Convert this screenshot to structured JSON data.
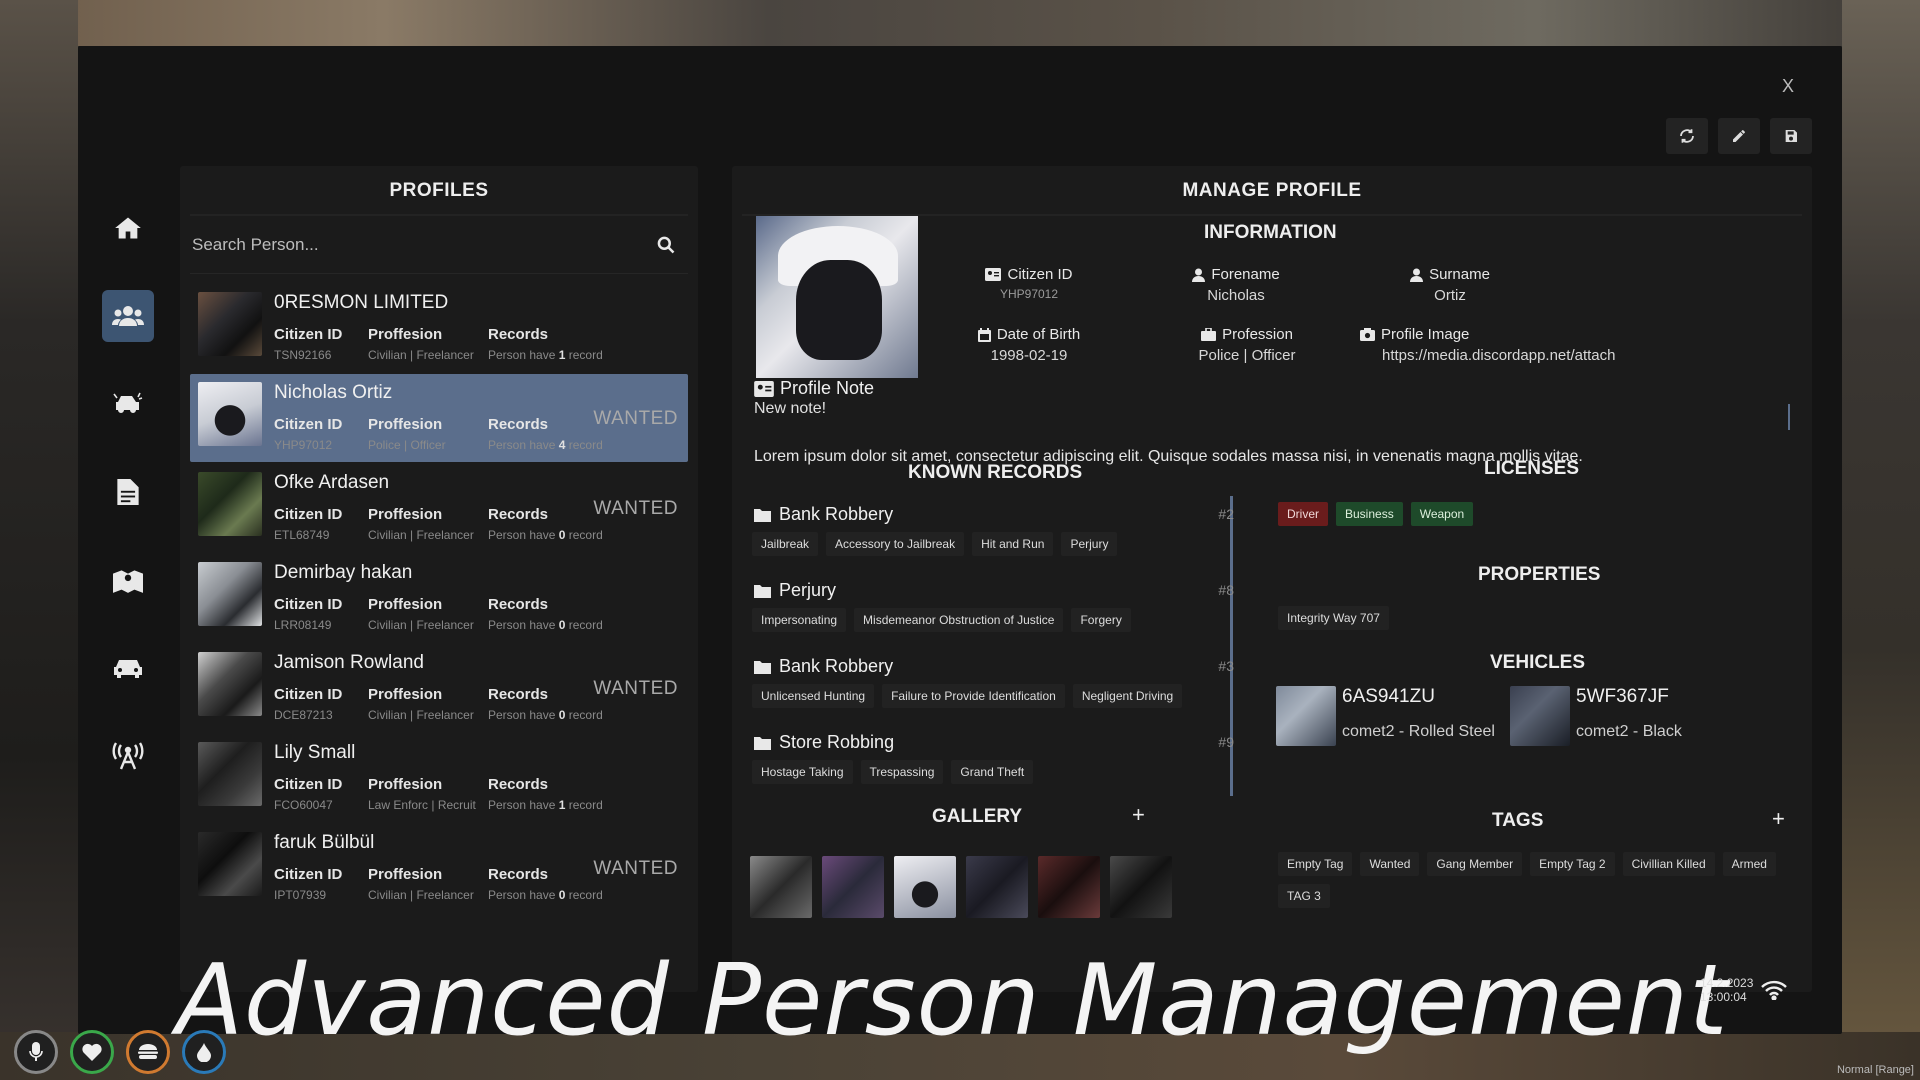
{
  "window": {
    "close_label": "X"
  },
  "nav": {
    "items": [
      "home-icon",
      "users-icon",
      "car-crash-icon",
      "document-icon",
      "map-icon",
      "car-icon",
      "radio-tower-icon"
    ],
    "active": 1
  },
  "profiles": {
    "title": "PROFILES",
    "search_placeholder": "Search Person...",
    "col_citizen": "Citizen ID",
    "col_profession": "Proffesion",
    "col_records": "Records",
    "wanted_label": "WANTED",
    "records_prefix": "Person have",
    "records_suffix": "record",
    "items": [
      {
        "name": "0RESMON LIMITED",
        "citizen_id": "TSN92166",
        "profession": "Civilian | Freelancer",
        "records": "1",
        "wanted": ""
      },
      {
        "name": "Nicholas Ortiz",
        "citizen_id": "YHP97012",
        "profession": "Police | Officer",
        "records": "4",
        "wanted": "WANTED"
      },
      {
        "name": "Ofke Ardasen",
        "citizen_id": "ETL68749",
        "profession": "Civilian | Freelancer",
        "records": "0",
        "wanted": "WANTED"
      },
      {
        "name": "Demirbay hakan",
        "citizen_id": "LRR08149",
        "profession": "Civilian | Freelancer",
        "records": "0",
        "wanted": ""
      },
      {
        "name": "Jamison Rowland",
        "citizen_id": "DCE87213",
        "profession": "Civilian | Freelancer",
        "records": "0",
        "wanted": "WANTED"
      },
      {
        "name": "Lily Small",
        "citizen_id": "FCO60047",
        "profession": "Law Enforc | Recruit",
        "records": "1",
        "wanted": ""
      },
      {
        "name": "faruk Bülbül",
        "citizen_id": "IPT07939",
        "profession": "Civilian | Freelancer",
        "records": "0",
        "wanted": "WANTED"
      }
    ],
    "selected": 1
  },
  "manage": {
    "title": "MANAGE PROFILE",
    "information_title": "INFORMATION",
    "citizen_id_label": "Citizen ID",
    "citizen_id": "YHP97012",
    "forename_label": "Forename",
    "forename": "Nicholas",
    "surname_label": "Surname",
    "surname": "Ortiz",
    "dob_label": "Date of Birth",
    "dob": "1998-02-19",
    "profession_label": "Profession",
    "profession": "Police | Officer",
    "image_label": "Profile Image",
    "image_url": "https://media.discordapp.net/attach",
    "note_title": "Profile Note",
    "note_sub": "New note!",
    "note_body": "Lorem ipsum dolor sit amet, consectetur adipiscing elit. Quisque sodales massa nisi, in venenatis magna mollis vitae.",
    "records_title": "KNOWN RECORDS",
    "records": [
      {
        "title": "Bank Robbery",
        "num": "#2",
        "tags": [
          "Jailbreak",
          "Accessory to Jailbreak",
          "Hit and Run",
          "Perjury"
        ]
      },
      {
        "title": "Perjury",
        "num": "#8",
        "tags": [
          "Impersonating",
          "Misdemeanor Obstruction of Justice",
          "Forgery"
        ]
      },
      {
        "title": "Bank Robbery",
        "num": "#3",
        "tags": [
          "Unlicensed Hunting",
          "Failure to Provide Identification",
          "Negligent Driving"
        ]
      },
      {
        "title": "Store Robbing",
        "num": "#9",
        "tags": [
          "Hostage Taking",
          "Trespassing",
          "Grand Theft"
        ]
      }
    ],
    "licenses_title": "LICENSES",
    "licenses": [
      "Driver",
      "Business",
      "Weapon"
    ],
    "properties_title": "PROPERTIES",
    "properties": [
      "Integrity Way 707"
    ],
    "vehicles_title": "VEHICLES",
    "vehicles": [
      {
        "plate": "6AS941ZU",
        "model": "comet2 - Rolled Steel"
      },
      {
        "plate": "5WF367JF",
        "model": "comet2 - Black"
      }
    ],
    "gallery_title": "GALLERY",
    "tags_title": "TAGS",
    "tags": [
      "Empty Tag",
      "Wanted",
      "Gang Member",
      "Empty Tag 2",
      "Civillian Killed",
      "Armed",
      "TAG 3"
    ],
    "add_label": "+"
  },
  "banner": "Advanced Person Management",
  "clock": {
    "date": "14.2.2023",
    "time": "13:00:04"
  },
  "corner_status": "Normal [Range]",
  "colors": {
    "accent": "#3d5572",
    "selected": "#5b6e8c",
    "driver": "#6a1c1c",
    "license_green": "#1e4a2a"
  }
}
